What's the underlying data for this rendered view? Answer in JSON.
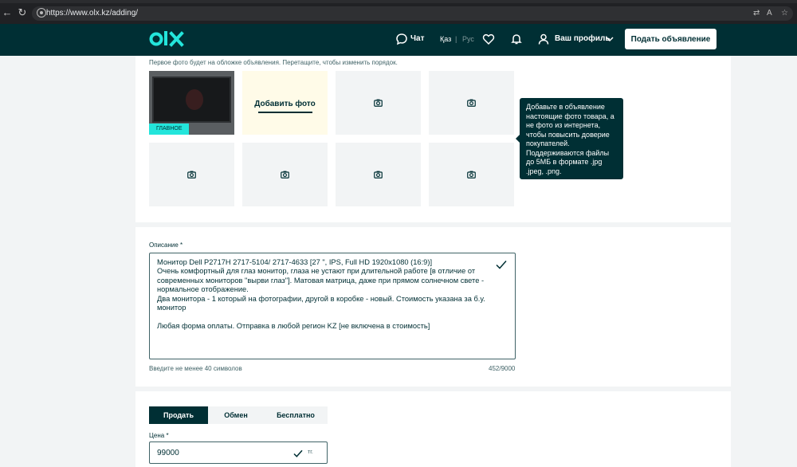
{
  "browser": {
    "url": "https://www.olx.kz/adding/"
  },
  "header": {
    "chat_label": "Чат",
    "lang_kz": "Қаз",
    "lang_sep": "|",
    "lang_ru": "Рус",
    "profile_label": "Ваш профиль",
    "post_button": "Подать объявление"
  },
  "photos": {
    "hint": "Первое фото будет на обложке объявления. Перетащите, чтобы изменить порядок.",
    "main_badge": "ГЛАВНОЕ",
    "add_label": "Добавить фото",
    "tooltip_lines": [
      "Добавьте в объявление",
      "настоящие фото товара, а",
      "не фото из интернета,",
      "чтобы повысить доверие",
      "покупателей.",
      "Поддерживаются файлы",
      "до 5МБ в формате .jpg",
      ".jpeg, .png."
    ]
  },
  "description": {
    "label": "Описание *",
    "lines": [
      "Монитор Dell P2717H 2717-5104/ 2717-4633 [27 \", IPS, Full HD 1920x1080 (16:9)]",
      "Очень комфортный для глаз монитор, глаза не устают при длительной работе [в отличие от",
      "современных мониторов \"вырви глаз\"]. Матовая матрица, даже при прямом солнечном свете -",
      "нормальное отображение.",
      "Два монитора - 1 который на фотографии, другой в коробке - новый.  Стоимость указана за б.у.",
      "монитор",
      "",
      "Любая форма оплаты. Отправка в любой регион KZ [не включена в стоимость]"
    ],
    "min_hint": "Введите не менее 40 символов",
    "counter": "452/9000"
  },
  "price": {
    "tabs": [
      "Продать",
      "Обмен",
      "Бесплатно"
    ],
    "label": "Цена *",
    "value": "99000",
    "currency": "тг."
  }
}
